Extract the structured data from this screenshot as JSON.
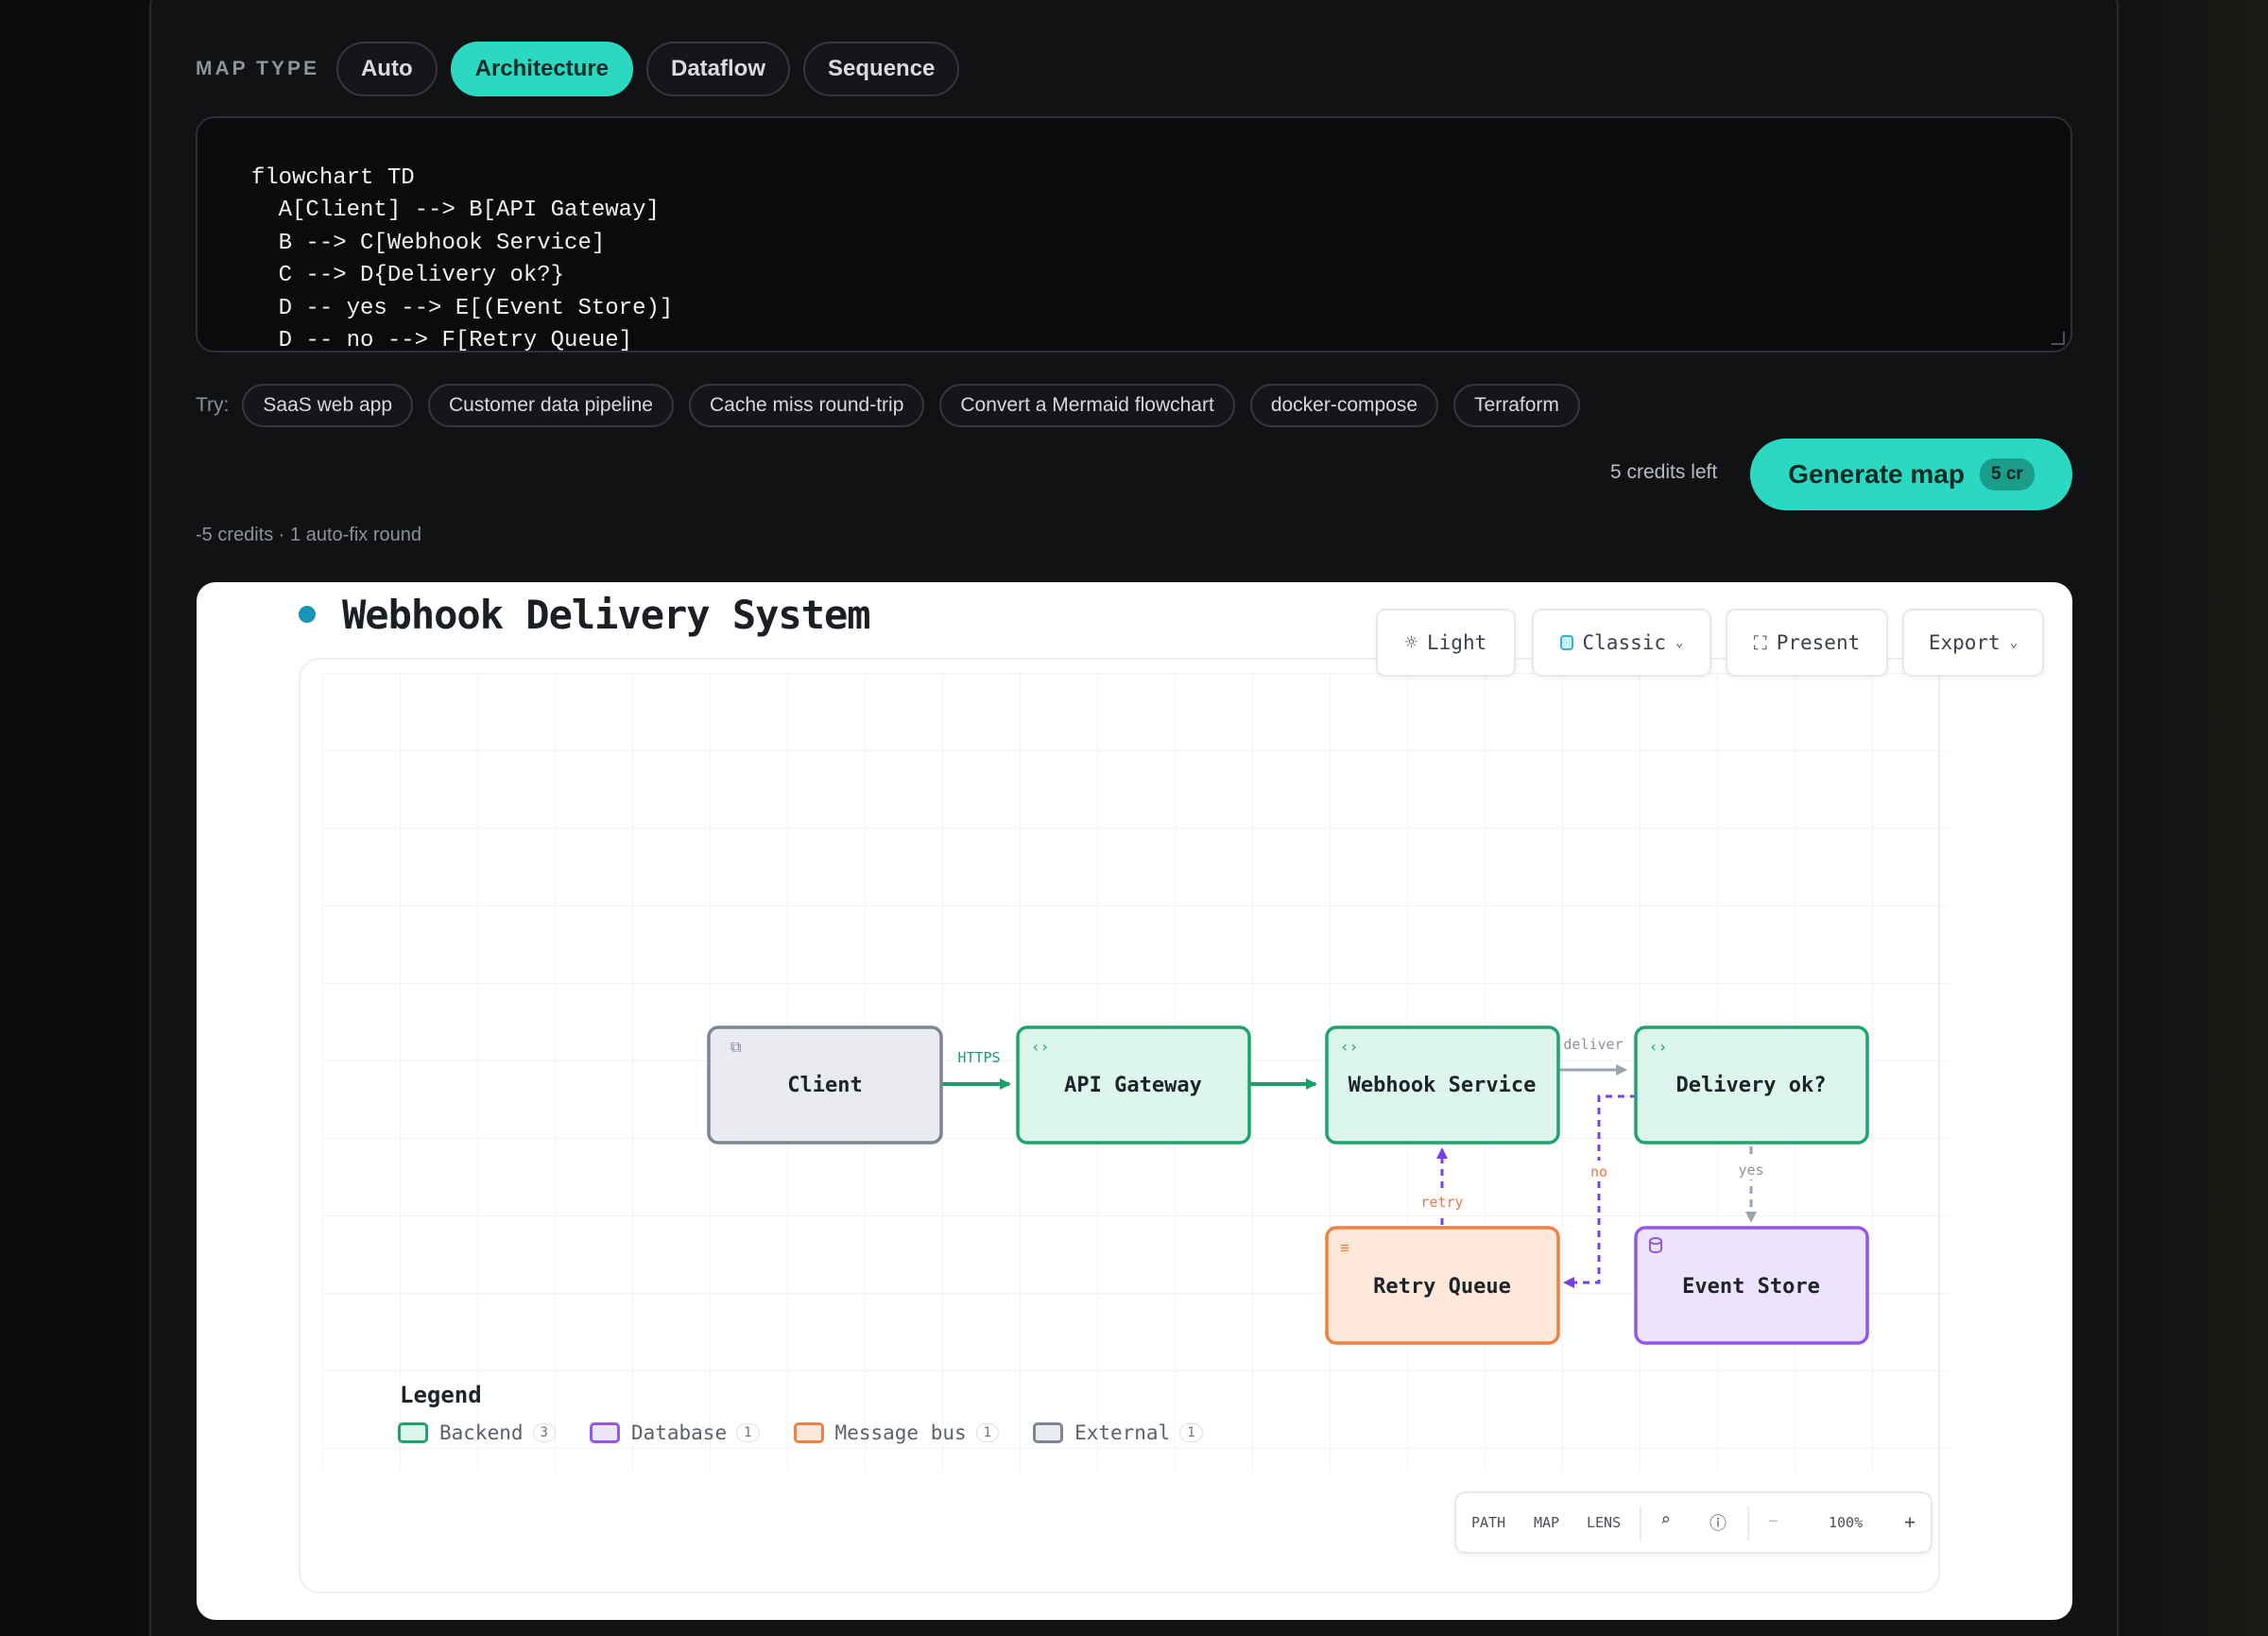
{
  "map_type": {
    "label": "MAP TYPE",
    "options": [
      "Auto",
      "Architecture",
      "Dataflow",
      "Sequence"
    ],
    "selected": "Architecture"
  },
  "editor": {
    "code": "flowchart TD\n    A[Client] --> B[API Gateway]\n    B --> C[Webhook Service]\n    C --> D{Delivery ok?}\n    D -- yes --> E[(Event Store)]\n    D -- no --> F[Retry Queue]\n    F --> C"
  },
  "try": {
    "label": "Try:",
    "chips": [
      "SaaS web app",
      "Customer data pipeline",
      "Cache miss round-trip",
      "Convert a Mermaid flowchart",
      "docker-compose",
      "Terraform"
    ]
  },
  "generate": {
    "credits_left": "5 credits left",
    "button_label": "Generate map",
    "cost_badge": "5 cr",
    "note": "-5 credits · 1 auto-fix round"
  },
  "canvas": {
    "title": "Webhook Delivery System",
    "toolbar": {
      "light": "Light",
      "style": "Classic",
      "present": "Present",
      "export": "Export"
    },
    "nodes": {
      "client": "Client",
      "api_gateway": "API Gateway",
      "webhook_service": "Webhook Service",
      "delivery_ok": "Delivery ok?",
      "retry_queue": "Retry Queue",
      "event_store": "Event Store"
    },
    "edge_labels": {
      "https": "HTTPS",
      "deliver": "deliver",
      "yes": "yes",
      "no": "no",
      "retry": "retry"
    },
    "legend": {
      "title": "Legend",
      "items": [
        {
          "label": "Backend",
          "count": "3",
          "color": "#1fa36e"
        },
        {
          "label": "Database",
          "count": "1",
          "color": "#9b6ae8"
        },
        {
          "label": "Message bus",
          "count": "1",
          "color": "#ef8a4a"
        },
        {
          "label": "External",
          "count": "1",
          "color": "#8a93a3"
        }
      ]
    },
    "controls": {
      "path": "PATH",
      "map": "MAP",
      "lens": "LENS",
      "minus": "−",
      "zoom": "100%",
      "plus": "+"
    }
  },
  "colors": {
    "accent": "#2bd9c2",
    "backend_fill": "#dcf6ec",
    "backend_stroke": "#1fa36e",
    "external_fill": "#e9ebf0",
    "external_stroke": "#7d8595",
    "bus_fill": "#fde8d9",
    "bus_stroke": "#ee8040",
    "db_fill": "#ece4fb",
    "db_stroke": "#9357e6"
  }
}
